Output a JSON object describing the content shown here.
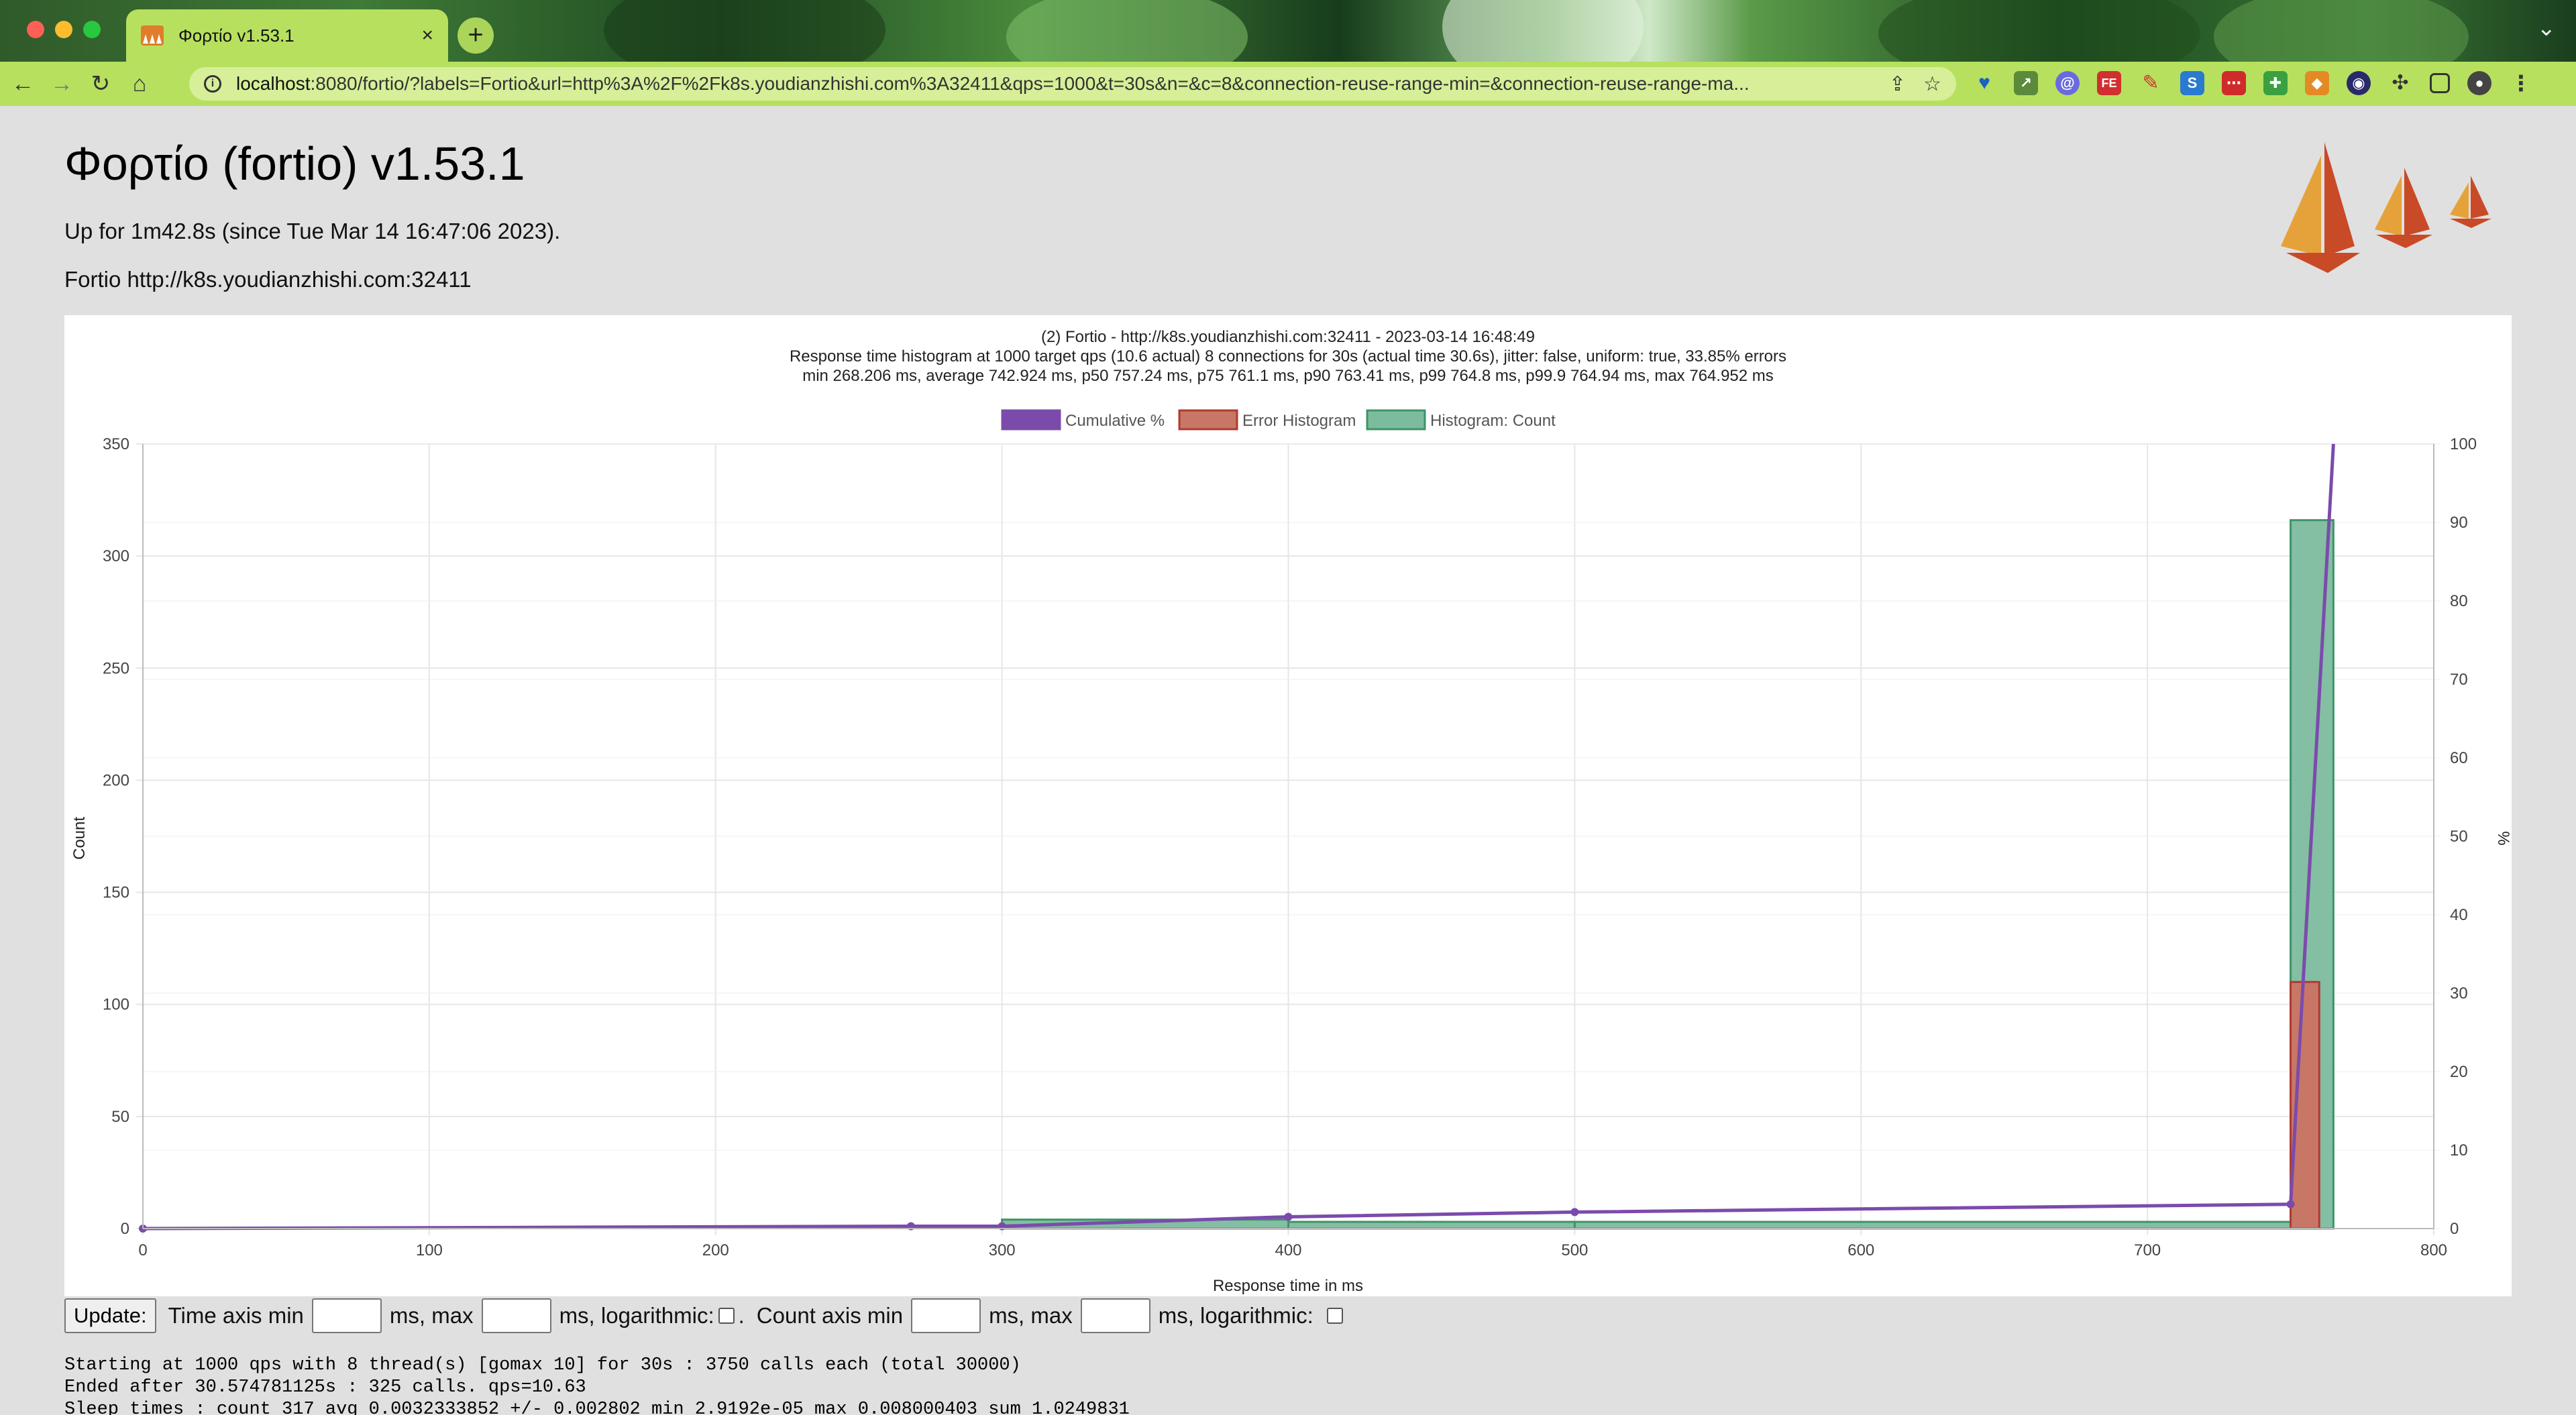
{
  "browser": {
    "tab_title": "Φορτίο v1.53.1",
    "tab_close": "×",
    "new_tab": "+",
    "url_host": "localhost",
    "url_rest": ":8080/fortio/?labels=Fortio&url=http%3A%2F%2Fk8s.youdianzhishi.com%3A32411&qps=1000&t=30s&n=&c=8&connection-reuse-range-min=&connection-reuse-range-ma...",
    "colors": {
      "tab_active": "#b7e05f",
      "toolbar": "#b7e05f",
      "omnibox": "#d6ef98"
    },
    "icons": [
      "back-icon",
      "forward-icon",
      "reload-icon",
      "home-icon",
      "site-info-icon",
      "share-icon",
      "bookmark-star-icon",
      "extensions-puzzle-icon",
      "side-panel-icon",
      "profile-avatar-icon"
    ]
  },
  "page": {
    "title": "Φορτίο (fortio) v1.53.1",
    "uptime": "Up for 1m42.8s (since Tue Mar 14 16:47:06 2023).",
    "fortio_url": "Fortio http://k8s.youdianzhishi.com:32411"
  },
  "chart_data": {
    "type": "bar",
    "title": "(2) Fortio - http://k8s.youdianzhishi.com:32411 - 2023-03-14 16:48:49",
    "subtitle": [
      "Response time histogram at 1000 target qps (10.6 actual) 8 connections for 30s (actual time 30.6s), jitter: false, uniform: true, 33.85% errors",
      "min 268.206 ms, average 742.924 ms, p50 757.24 ms, p75 761.1 ms, p90 763.41 ms, p99 764.8 ms, p99.9 764.94 ms, max 764.952 ms"
    ],
    "xlabel": "Response time in ms",
    "ylabel": "Count",
    "y2label": "%",
    "xlim": [
      0,
      800
    ],
    "ylim": [
      0,
      350
    ],
    "y2lim": [
      0,
      100
    ],
    "x_ticks": [
      0,
      100,
      200,
      300,
      400,
      500,
      600,
      700,
      800
    ],
    "y_ticks": [
      0,
      50,
      100,
      150,
      200,
      250,
      300,
      350
    ],
    "y2_ticks": [
      0,
      10,
      20,
      30,
      40,
      50,
      60,
      70,
      80,
      90,
      100
    ],
    "grid": true,
    "legend_position": "top-center",
    "legend": [
      "Cumulative %",
      "Error Histogram",
      "Histogram: Count"
    ],
    "colors": {
      "cumulative": "#7b4bab",
      "error_fill": "#c87766",
      "error_border": "#b03a2e",
      "count_fill": "#7dbb9e",
      "count_border": "#3d9467"
    },
    "histogram_count": [
      {
        "start": 268.206,
        "end": 300,
        "count": 0
      },
      {
        "start": 300,
        "end": 400,
        "count": 4
      },
      {
        "start": 400,
        "end": 500,
        "count": 3
      },
      {
        "start": 500,
        "end": 750,
        "count": 3
      },
      {
        "start": 750,
        "end": 764.952,
        "count": 316
      }
    ],
    "error_histogram": [
      {
        "start": 750,
        "end": 760,
        "count": 110
      }
    ],
    "cumulative_percent": [
      {
        "x": 0,
        "y": 0
      },
      {
        "x": 268.206,
        "y": 0.3
      },
      {
        "x": 300,
        "y": 0.3
      },
      {
        "x": 400,
        "y": 1.5
      },
      {
        "x": 500,
        "y": 2.1
      },
      {
        "x": 750,
        "y": 3.1
      },
      {
        "x": 764.952,
        "y": 100
      }
    ]
  },
  "controls": {
    "update_label": "Update:",
    "time_axis_min": "Time axis min",
    "ms_max": "ms, max",
    "ms_log": "ms, logarithmic:",
    "dot": ".",
    "count_axis_min": "Count axis min",
    "ms_max_2": "ms, max",
    "ms_log_2": "ms, logarithmic:"
  },
  "log": [
    "Starting at 1000 qps with 8 thread(s) [gomax 10] for 30s : 3750 calls each (total 30000)",
    "Ended after 30.574781125s : 325 calls. qps=10.63",
    "Sleep times : count 317 avg 0.0032333852 +/- 0.002802 min 2.9192e-05 max 0.008000403 sum 1.0249831"
  ]
}
